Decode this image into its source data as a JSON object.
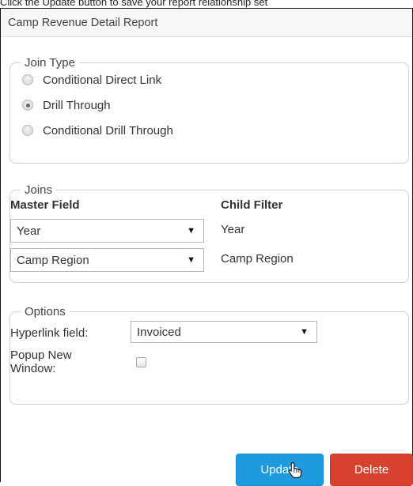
{
  "caption": "Click the Update button to save your report relationship set",
  "dialog": {
    "title": "Camp Revenue Detail Report"
  },
  "join_type": {
    "legend": "Join Type",
    "options": [
      {
        "label": "Conditional Direct Link",
        "checked": false
      },
      {
        "label": "Drill Through",
        "checked": true
      },
      {
        "label": "Conditional Drill Through",
        "checked": false
      }
    ]
  },
  "joins": {
    "legend": "Joins",
    "master_header": "Master Field",
    "child_header": "Child Filter",
    "rows": [
      {
        "master": "Year",
        "child": "Year"
      },
      {
        "master": "Camp Region",
        "child": "Camp Region"
      }
    ]
  },
  "options": {
    "legend": "Options",
    "hyperlink_label": "Hyperlink field:",
    "hyperlink_value": "Invoiced",
    "popup_label_line1": "Popup New",
    "popup_label_line2": "Window:",
    "popup_checked": false
  },
  "buttons": {
    "update": "Update",
    "delete": "Delete"
  },
  "colors": {
    "update": "#1e9be0",
    "delete": "#d9412f"
  }
}
